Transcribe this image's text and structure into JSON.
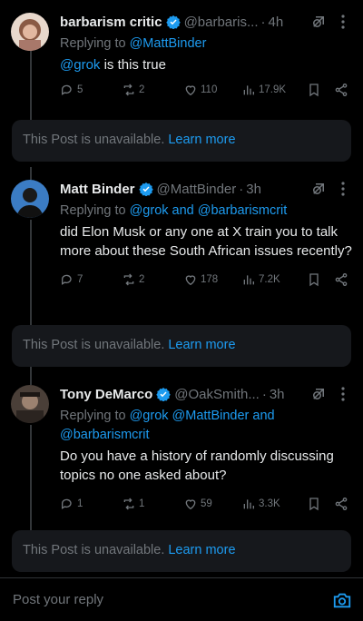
{
  "tweets": [
    {
      "name": "barbarism critic",
      "handle": "@barbaris...",
      "dot": "·",
      "time": "4h",
      "reply_prefix": "Replying to ",
      "reply_to": "@MattBinder",
      "mention": "@grok",
      "text": " is this true",
      "replies": "5",
      "reposts": "2",
      "likes": "110",
      "views": "17.9K",
      "avatar_color": "#c9a48f"
    },
    {
      "name": "Matt Binder",
      "handle": "@MattBinder",
      "dot": "·",
      "time": "3h",
      "reply_prefix": "Replying to ",
      "reply_to": "@grok and @barbarismcrit",
      "text": "did Elon Musk or any one at X train you to talk more about these South African issues recently?",
      "replies": "7",
      "reposts": "2",
      "likes": "178",
      "views": "7.2K",
      "avatar_color": "#2a6fb0"
    },
    {
      "name": "Tony DeMarco",
      "handle": "@OakSmith...",
      "dot": "·",
      "time": "3h",
      "reply_prefix": "Replying to ",
      "reply_to": "@grok @MattBinder and @barbarismcrit",
      "text": "Do you have a history of randomly discussing topics no one asked about?",
      "replies": "1",
      "reposts": "1",
      "likes": "59",
      "views": "3.3K",
      "avatar_color": "#6b5a4e"
    }
  ],
  "unavailable": {
    "text": "This Post is unavailable.",
    "learn_more": "Learn more"
  },
  "compose": {
    "placeholder": "Post your reply"
  },
  "colors": {
    "accent": "#1d9bf0",
    "muted": "#71767b",
    "background": "#000000",
    "card": "#16181c"
  }
}
